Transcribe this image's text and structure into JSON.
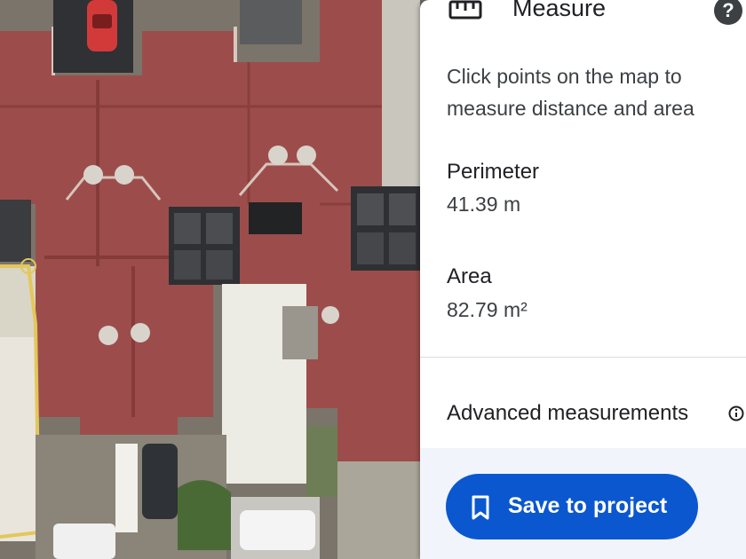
{
  "panel": {
    "title": "Measure",
    "description": "Click points on the map to measure distance and area",
    "perimeter_label": "Perimeter",
    "perimeter_value": "41.39 m",
    "area_label": "Area",
    "area_value": "82.79 m²",
    "advanced_label": "Advanced measurements",
    "save_label": "Save to project",
    "icons": {
      "title": "ruler-icon",
      "help": "help-icon",
      "advanced": "info-icon",
      "save": "bookmark-icon"
    },
    "colors": {
      "primary_button": "#0b57d0",
      "footer_bg": "#f1f4fa",
      "roof": "#9c4d4b",
      "measurement_outline": "#e3c75a"
    }
  },
  "map": {
    "view": "satellite"
  }
}
